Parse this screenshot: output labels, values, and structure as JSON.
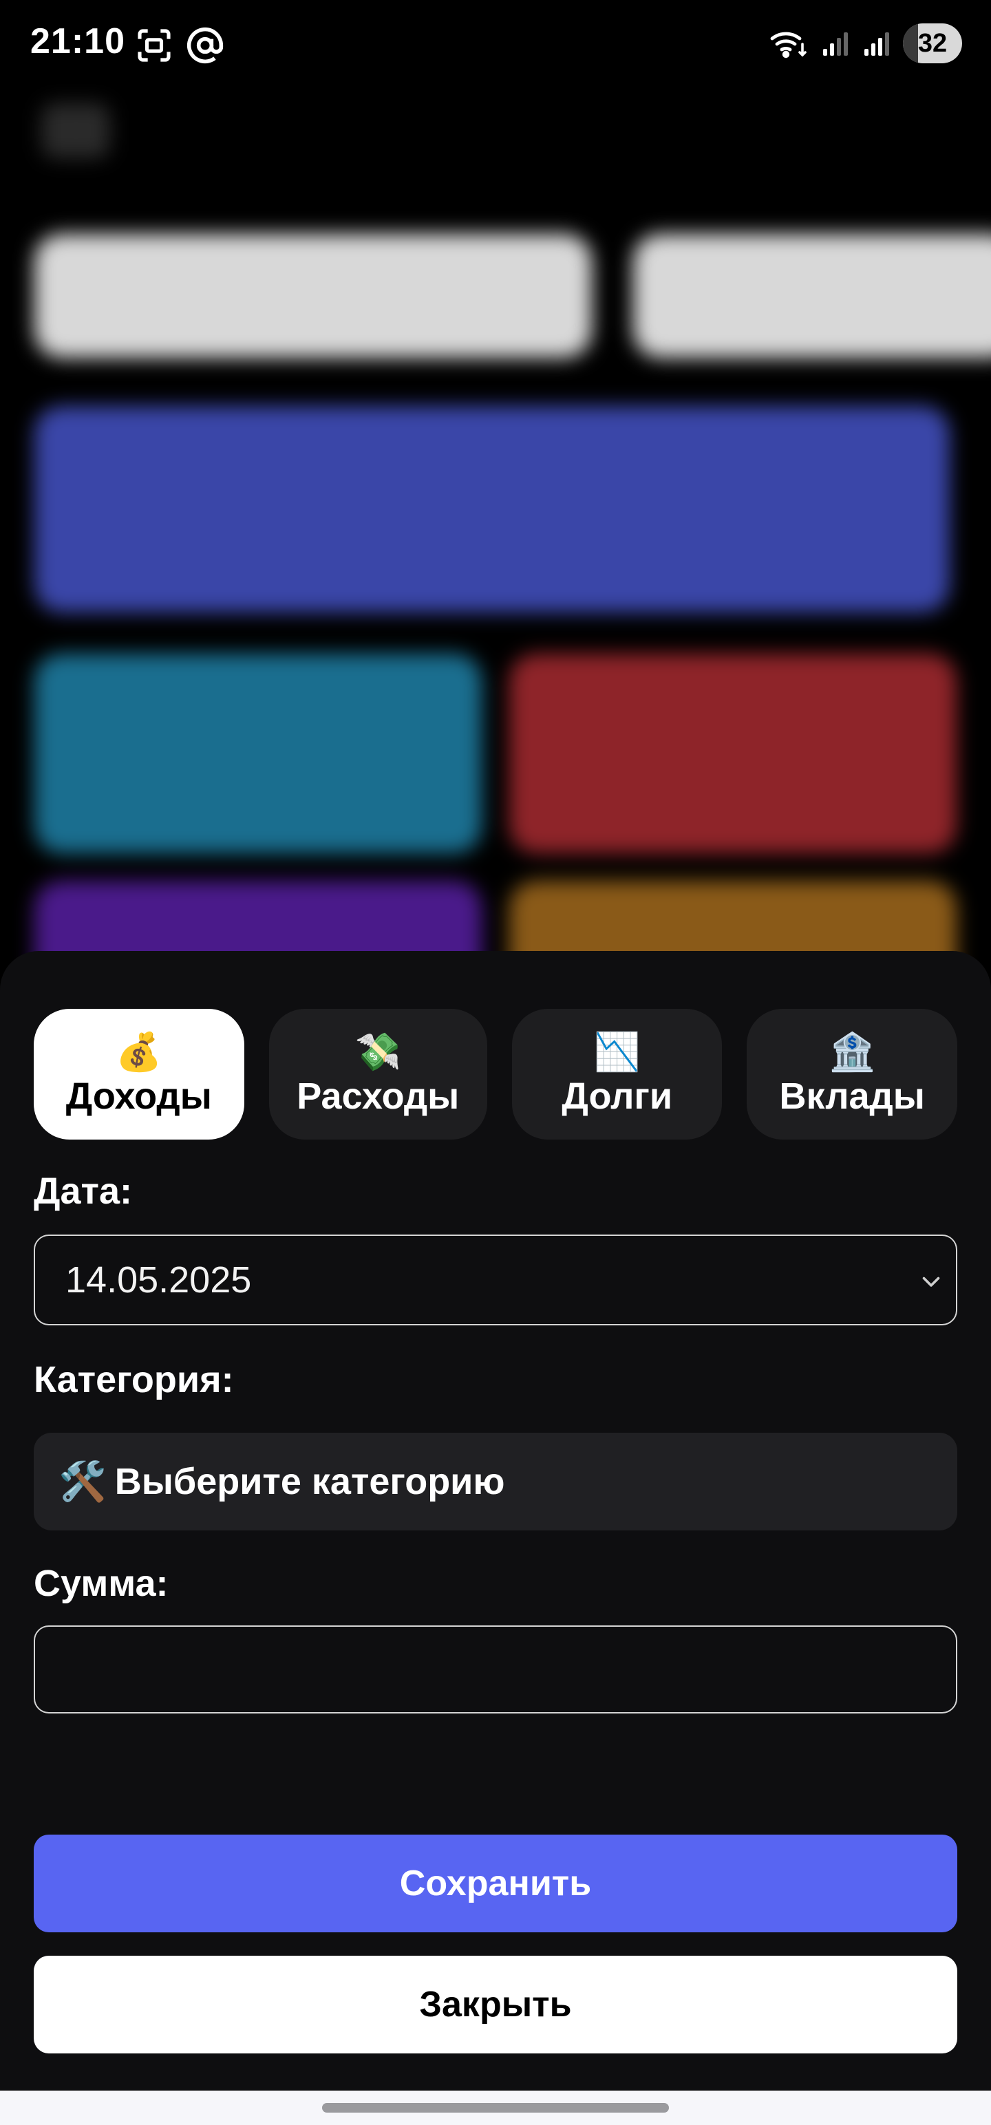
{
  "status_bar": {
    "time": "21:10",
    "battery": "32",
    "icons": [
      "screenshot-icon",
      "at-sign-icon",
      "wifi-icon",
      "signal-icon",
      "signal-icon",
      "battery-icon"
    ]
  },
  "tabs": [
    {
      "emoji": "💰",
      "label": "Доходы",
      "active": true
    },
    {
      "emoji": "💸",
      "label": "Расходы",
      "active": false
    },
    {
      "emoji": "📉",
      "label": "Долги",
      "active": false
    },
    {
      "emoji": "🏦",
      "label": "Вклады",
      "active": false
    }
  ],
  "form": {
    "date_label": "Дата:",
    "date_value": "14.05.2025",
    "category_label": "Категория:",
    "category_emoji": "🛠️",
    "category_placeholder": "Выберите категорию",
    "amount_label": "Сумма:",
    "amount_value": ""
  },
  "actions": {
    "save_label": "Сохранить",
    "close_label": "Закрыть"
  },
  "colors": {
    "accent": "#5865f2",
    "sheet_background": "#0e0e10",
    "active_tab": "#ffffff",
    "inactive_tab": "#1e1e20"
  }
}
